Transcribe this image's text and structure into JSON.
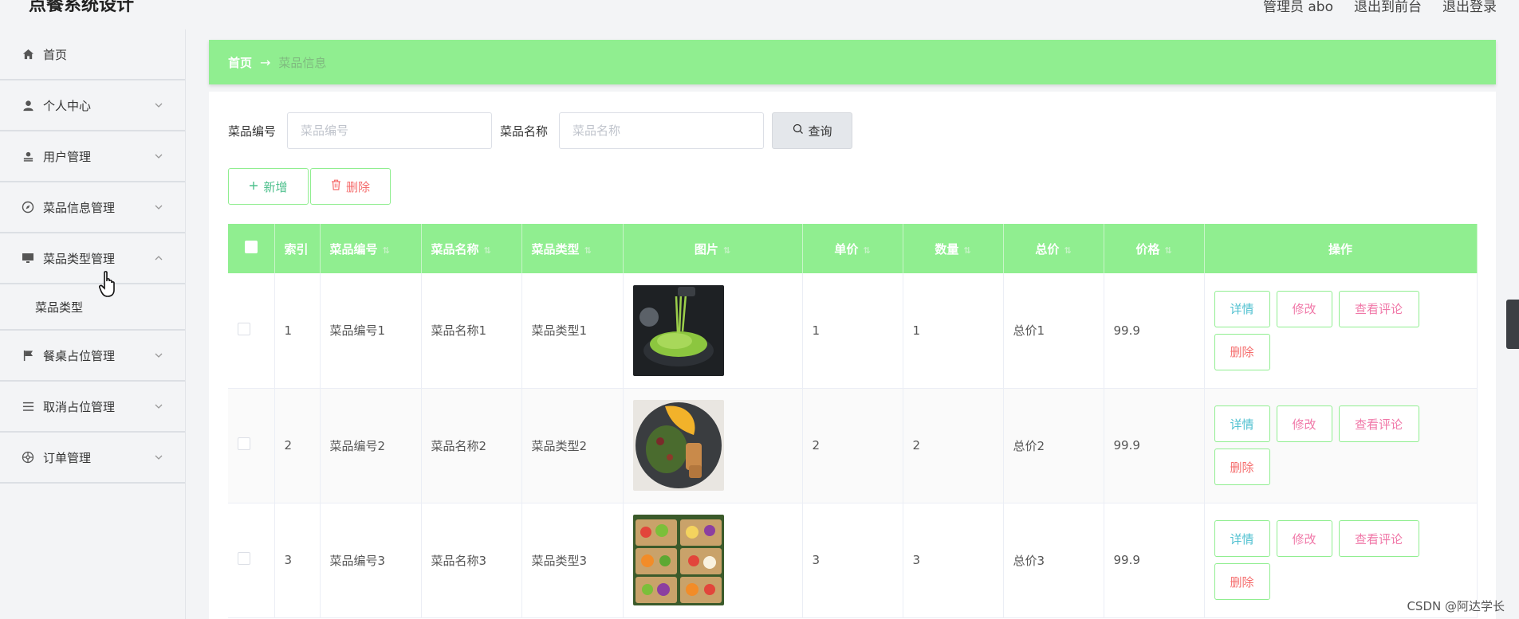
{
  "header": {
    "title": "点餐系统设计",
    "admin_label": "管理员 abo",
    "back_link": "退出到前台",
    "logout_link": "退出登录"
  },
  "sidebar": {
    "items": [
      {
        "label": "首页",
        "icon": "home-icon"
      },
      {
        "label": "个人中心",
        "icon": "user-icon"
      },
      {
        "label": "用户管理",
        "icon": "user-manage-icon"
      },
      {
        "label": "菜品信息管理",
        "icon": "compass-icon"
      },
      {
        "label": "菜品类型管理",
        "icon": "monitor-icon"
      },
      {
        "label": "餐桌占位管理",
        "icon": "flag-icon"
      },
      {
        "label": "取消占位管理",
        "icon": "list-icon"
      },
      {
        "label": "订单管理",
        "icon": "aperture-icon"
      }
    ],
    "submenu_label": "菜品类型"
  },
  "breadcrumb": {
    "home": "首页",
    "arrow": "→",
    "current": "菜品信息"
  },
  "search": {
    "code_label": "菜品编号",
    "code_placeholder": "菜品编号",
    "name_label": "菜品名称",
    "name_placeholder": "菜品名称",
    "query_label": "查询"
  },
  "actions": {
    "add_label": "新增",
    "delete_label": "删除"
  },
  "table": {
    "headers": [
      "索引",
      "菜品编号",
      "菜品名称",
      "菜品类型",
      "图片",
      "单价",
      "数量",
      "总价",
      "价格",
      "操作"
    ],
    "rows": [
      {
        "index": "1",
        "code": "菜品编号1",
        "name": "菜品名称1",
        "type": "菜品类型1",
        "unit_price": "1",
        "quantity": "1",
        "total": "总价1",
        "price": "99.9"
      },
      {
        "index": "2",
        "code": "菜品编号2",
        "name": "菜品名称2",
        "type": "菜品类型2",
        "unit_price": "2",
        "quantity": "2",
        "total": "总价2",
        "price": "99.9"
      },
      {
        "index": "3",
        "code": "菜品编号3",
        "name": "菜品名称3",
        "type": "菜品类型3",
        "unit_price": "3",
        "quantity": "3",
        "total": "总价3",
        "price": "99.9"
      }
    ],
    "op_labels": {
      "detail": "详情",
      "edit": "修改",
      "review": "查看评论",
      "delete": "删除"
    }
  },
  "watermark": "CSDN @阿达学长",
  "colors": {
    "accent_green": "#90ee90",
    "danger_red": "#f56c6c",
    "pink": "#f078a8",
    "teal": "#4fc0d0"
  }
}
